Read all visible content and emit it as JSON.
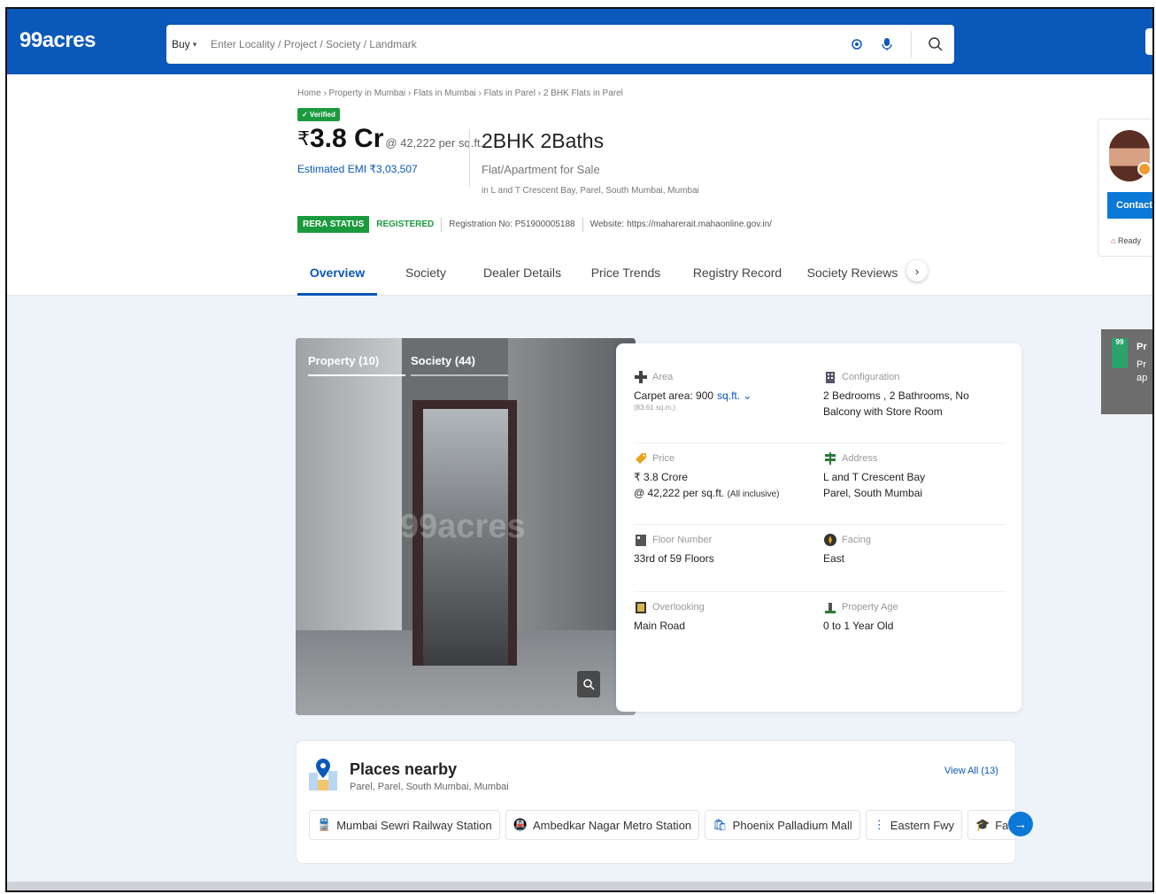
{
  "header": {
    "logo": "99acres",
    "buy_label": "Buy",
    "search_placeholder": "Enter Locality / Project / Society / Landmark"
  },
  "detail": {
    "breadcrumb": "Home › Property in Mumbai › Flats in Mumbai › Flats in Parel › 2 BHK Flats in Parel",
    "verified": "✓ Verified",
    "price_symbol": "₹",
    "price_amount": "3.8 Cr",
    "price_per_sqft": "@ 42,222 per sq.ft.",
    "emi": "Estimated EMI ₹3,03,507",
    "title": "2BHK 2Baths",
    "type": "Flat/Apartment for Sale",
    "address": "in L and T Crescent Bay, Parel, South Mumbai, Mumbai",
    "rera_status": "RERA STATUS",
    "rera_registered": "REGISTERED",
    "registration_no": "Registration No: P51900005188",
    "website": "Website: https://maharerait.mahaonline.gov.in/"
  },
  "tabs": [
    {
      "label": "Overview"
    },
    {
      "label": "Society"
    },
    {
      "label": "Dealer Details"
    },
    {
      "label": "Price Trends"
    },
    {
      "label": "Registry Record"
    },
    {
      "label": "Society Reviews"
    }
  ],
  "agent": {
    "contact": "Contact",
    "ready": "Ready"
  },
  "promo": {
    "flag": "99",
    "line1": "Pr",
    "line2": "Pr",
    "line3": "ap"
  },
  "gallery": {
    "tab_property": "Property (10)",
    "tab_society": "Society (44)",
    "watermark": "99acres"
  },
  "info": {
    "area_label": "Area",
    "area_value": "Carpet area: 900",
    "area_unit": "sq.ft. ⌄",
    "area_sub": "(83.61 sq.m.)",
    "config_label": "Configuration",
    "config_value": "2 Bedrooms , 2 Bathrooms, No Balcony with Store Room",
    "price_label": "Price",
    "price_value": "₹ 3.8 Crore",
    "price_sub": "@ 42,222 per sq.ft.",
    "price_incl": "(All inclusive)",
    "address_label": "Address",
    "address_line1": "L and T Crescent Bay",
    "address_line2": "Parel, South Mumbai",
    "floor_label": "Floor Number",
    "floor_value": "33rd  of 59 Floors",
    "facing_label": "Facing",
    "facing_value": "East",
    "overlooking_label": "Overlooking",
    "overlooking_value": "Main Road",
    "age_label": "Property Age",
    "age_value": "0 to 1 Year Old"
  },
  "places": {
    "title": "Places nearby",
    "subtitle": "Parel, Parel, South Mumbai, Mumbai",
    "view_all": "View All (13)",
    "chips": [
      {
        "label": "Mumbai Sewri Railway Station",
        "icon": "train-icon"
      },
      {
        "label": "Ambedkar Nagar Metro Station",
        "icon": "metro-icon"
      },
      {
        "label": "Phoenix Palladium Mall",
        "icon": "mall-icon"
      },
      {
        "label": "Eastern Fwy",
        "icon": "road-icon"
      },
      {
        "label": "Fatima High",
        "icon": "school-icon"
      }
    ]
  },
  "colors": {
    "brand_blue": "#0a58b9",
    "verified_green": "#1c9a3e"
  }
}
